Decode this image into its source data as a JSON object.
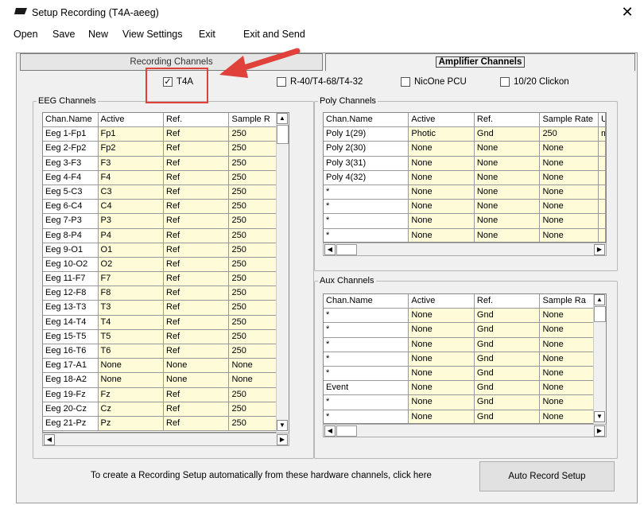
{
  "window": {
    "title": "Setup Recording (T4A-aeeg)",
    "close_symbol": "✕"
  },
  "menu": [
    "Open",
    "Save",
    "New",
    "View Settings",
    "Exit",
    "Exit and Send"
  ],
  "tabs": {
    "recording": "Recording Channels",
    "amplifier": "Amplifier Channels"
  },
  "checkboxes": [
    {
      "label": "T4A",
      "checked": true
    },
    {
      "label": "R-40/T4-68/T4-32",
      "checked": false
    },
    {
      "label": "NicOne PCU",
      "checked": false
    },
    {
      "label": "10/20 Clickon",
      "checked": false
    }
  ],
  "eeg": {
    "legend": "EEG Channels",
    "headers": [
      "Chan.Name",
      "Active",
      "Ref.",
      "Sample R"
    ],
    "rows": [
      [
        "Eeg 1-Fp1",
        "Fp1",
        "Ref",
        "250"
      ],
      [
        "Eeg 2-Fp2",
        "Fp2",
        "Ref",
        "250"
      ],
      [
        "Eeg 3-F3",
        "F3",
        "Ref",
        "250"
      ],
      [
        "Eeg 4-F4",
        "F4",
        "Ref",
        "250"
      ],
      [
        "Eeg 5-C3",
        "C3",
        "Ref",
        "250"
      ],
      [
        "Eeg 6-C4",
        "C4",
        "Ref",
        "250"
      ],
      [
        "Eeg 7-P3",
        "P3",
        "Ref",
        "250"
      ],
      [
        "Eeg 8-P4",
        "P4",
        "Ref",
        "250"
      ],
      [
        "Eeg 9-O1",
        "O1",
        "Ref",
        "250"
      ],
      [
        "Eeg 10-O2",
        "O2",
        "Ref",
        "250"
      ],
      [
        "Eeg 11-F7",
        "F7",
        "Ref",
        "250"
      ],
      [
        "Eeg 12-F8",
        "F8",
        "Ref",
        "250"
      ],
      [
        "Eeg 13-T3",
        "T3",
        "Ref",
        "250"
      ],
      [
        "Eeg 14-T4",
        "T4",
        "Ref",
        "250"
      ],
      [
        "Eeg 15-T5",
        "T5",
        "Ref",
        "250"
      ],
      [
        "Eeg 16-T6",
        "T6",
        "Ref",
        "250"
      ],
      [
        "Eeg 17-A1",
        "None",
        "None",
        "None"
      ],
      [
        "Eeg 18-A2",
        "None",
        "None",
        "None"
      ],
      [
        "Eeg 19-Fz",
        "Fz",
        "Ref",
        "250"
      ],
      [
        "Eeg 20-Cz",
        "Cz",
        "Ref",
        "250"
      ],
      [
        "Eeg 21-Pz",
        "Pz",
        "Ref",
        "250"
      ]
    ]
  },
  "poly": {
    "legend": "Poly Channels",
    "headers": [
      "Chan.Name",
      "Active",
      "Ref.",
      "Sample Rate",
      "U"
    ],
    "rows": [
      [
        "Poly 1(29)",
        "Photic",
        "Gnd",
        "250",
        "m"
      ],
      [
        "Poly 2(30)",
        "None",
        "None",
        "None",
        ""
      ],
      [
        "Poly 3(31)",
        "None",
        "None",
        "None",
        ""
      ],
      [
        "Poly 4(32)",
        "None",
        "None",
        "None",
        ""
      ],
      [
        "*",
        "None",
        "None",
        "None",
        ""
      ],
      [
        "*",
        "None",
        "None",
        "None",
        ""
      ],
      [
        "*",
        "None",
        "None",
        "None",
        ""
      ],
      [
        "*",
        "None",
        "None",
        "None",
        ""
      ]
    ]
  },
  "aux": {
    "legend": "Aux Channels",
    "headers": [
      "Chan.Name",
      "Active",
      "Ref.",
      "Sample Ra"
    ],
    "rows": [
      [
        "*",
        "None",
        "Gnd",
        "None"
      ],
      [
        "*",
        "None",
        "Gnd",
        "None"
      ],
      [
        "*",
        "None",
        "Gnd",
        "None"
      ],
      [
        "*",
        "None",
        "Gnd",
        "None"
      ],
      [
        "*",
        "None",
        "Gnd",
        "None"
      ],
      [
        "Event",
        "None",
        "Gnd",
        "None"
      ],
      [
        "*",
        "None",
        "Gnd",
        "None"
      ],
      [
        "*",
        "None",
        "Gnd",
        "None"
      ]
    ]
  },
  "footer": {
    "text": "To create a Recording Setup automatically from these hardware channels, click here",
    "button": "Auto Record Setup"
  },
  "colors": {
    "cell_bg": "#fdfbd8",
    "annotation": "#e0413a"
  }
}
